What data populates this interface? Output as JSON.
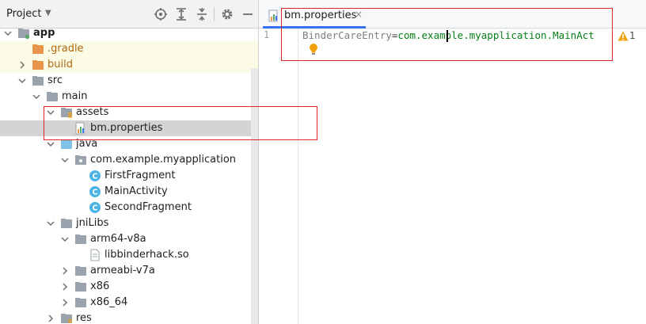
{
  "project_panel": {
    "title": "Project",
    "toolbar_icons": [
      "locate-icon",
      "expand-all-icon",
      "collapse-all-icon",
      "settings-gear-icon",
      "hide-panel-icon"
    ],
    "tree": [
      {
        "label": "app",
        "icon": "module-folder-icon",
        "bold": true,
        "expanded": true
      },
      {
        "label": ".gradle",
        "icon": "folder-orange-icon",
        "style": "excluded"
      },
      {
        "label": "build",
        "icon": "folder-orange-icon",
        "style": "excluded"
      },
      {
        "label": "src",
        "icon": "folder-icon",
        "expanded": true
      },
      {
        "label": "main",
        "icon": "folder-icon",
        "expanded": true
      },
      {
        "label": "assets",
        "icon": "assets-folder-icon",
        "expanded": true
      },
      {
        "label": "bm.properties",
        "icon": "properties-file-icon",
        "selected": true
      },
      {
        "label": "java",
        "icon": "source-folder-icon",
        "expanded": true
      },
      {
        "label": "com.example.myapplication",
        "icon": "package-icon",
        "expanded": true
      },
      {
        "label": "FirstFragment",
        "icon": "class-icon"
      },
      {
        "label": "MainActivity",
        "icon": "class-icon"
      },
      {
        "label": "SecondFragment",
        "icon": "class-icon"
      },
      {
        "label": "jniLibs",
        "icon": "folder-icon",
        "expanded": true
      },
      {
        "label": "arm64-v8a",
        "icon": "folder-icon",
        "expanded": true
      },
      {
        "label": "libbinderhack.so",
        "icon": "file-icon"
      },
      {
        "label": "armeabi-v7a",
        "icon": "folder-icon",
        "expanded": false
      },
      {
        "label": "x86",
        "icon": "folder-icon",
        "expanded": false
      },
      {
        "label": "x86_64",
        "icon": "folder-icon",
        "expanded": false
      },
      {
        "label": "res",
        "icon": "resources-folder-icon",
        "expanded": false
      }
    ]
  },
  "editor": {
    "tab": {
      "label": "bm.properties",
      "close_glyph": "×",
      "icon": "properties-file-icon"
    },
    "line_number": "1",
    "code": {
      "key": "BinderCareEntry",
      "separator": "=",
      "value": "com.example.myapplication.MainAct"
    },
    "inspection": {
      "count": "1",
      "icon": "warning-triangle-icon"
    },
    "intention_icon": "lightbulb-icon"
  },
  "colors": {
    "accent": "#3574f0",
    "annotation_red": "#e0252a",
    "string_green": "#067d17",
    "excluded_orange": "#e8954c",
    "folder_grey": "#9aa3ad",
    "source_blue": "#7fc4e8",
    "class_blue": "#4db4e6",
    "warning_yellow": "#f0a20b"
  }
}
